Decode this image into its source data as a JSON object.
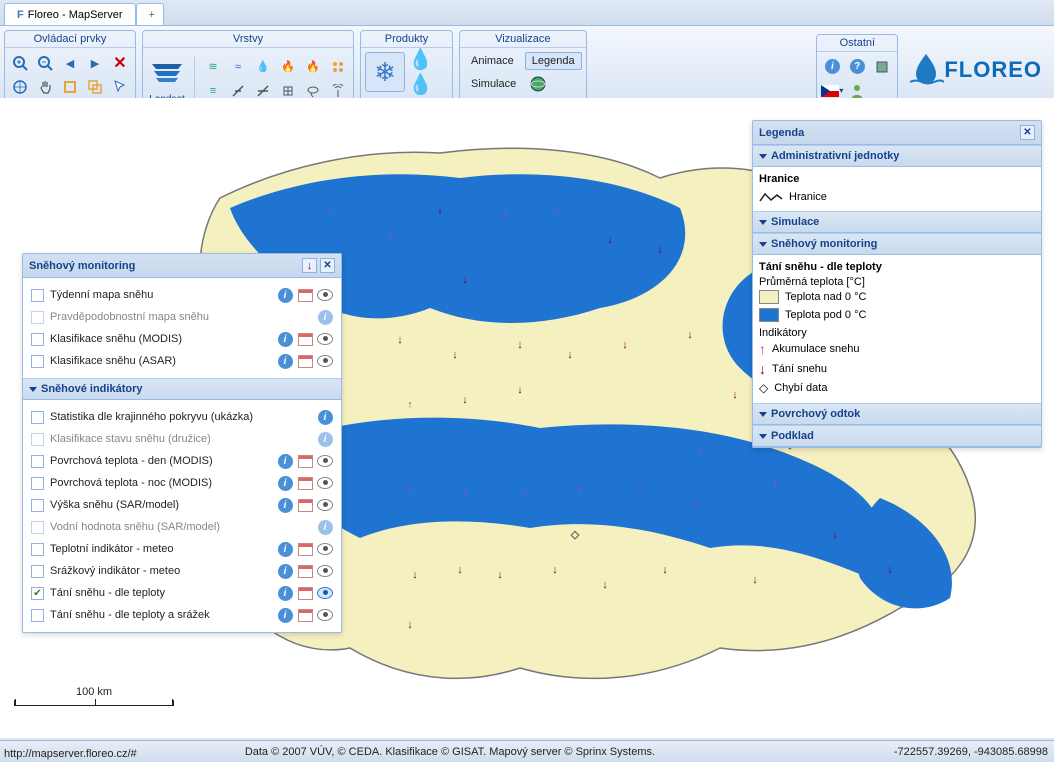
{
  "window": {
    "title": "Floreo - MapServer"
  },
  "ribbon": {
    "groups": {
      "controls": "Ovládací prvky",
      "layers": "Vrstvy",
      "products": "Produkty",
      "visualization": "Vizualizace",
      "other": "Ostatní"
    },
    "landsat": "Landsat",
    "vis": {
      "animace": "Animace",
      "legenda": "Legenda",
      "simulace": "Simulace"
    }
  },
  "brand": "FLOREO",
  "snowPanel": {
    "title": "Sněhový monitoring",
    "section1": {
      "items": [
        {
          "label": "Týdenní mapa sněhu",
          "checked": false,
          "cal": true,
          "eye": true
        },
        {
          "label": "Pravděpodobnostní mapa sněhu",
          "checked": false,
          "cal": false,
          "eye": false,
          "dim": true
        },
        {
          "label": "Klasifikace sněhu (MODIS)",
          "checked": false,
          "cal": true,
          "eye": true
        },
        {
          "label": "Klasifikace sněhu (ASAR)",
          "checked": false,
          "cal": true,
          "eye": true
        }
      ]
    },
    "section2": {
      "title": "Sněhové indikátory",
      "items": [
        {
          "label": "Statistika dle krajinného pokryvu (ukázka)",
          "checked": false,
          "cal": false,
          "eye": false
        },
        {
          "label": "Klasifikace stavu sněhu (družice)",
          "checked": false,
          "cal": false,
          "eye": false,
          "dim": true
        },
        {
          "label": "Povrchová teplota - den (MODIS)",
          "checked": false,
          "cal": true,
          "eye": true
        },
        {
          "label": "Povrchová teplota - noc (MODIS)",
          "checked": false,
          "cal": true,
          "eye": true
        },
        {
          "label": "Výška sněhu (SAR/model)",
          "checked": false,
          "cal": true,
          "eye": true
        },
        {
          "label": "Vodní hodnota sněhu (SAR/model)",
          "checked": false,
          "cal": false,
          "eye": false,
          "dim": true
        },
        {
          "label": "Teplotní indikátor - meteo",
          "checked": false,
          "cal": true,
          "eye": true
        },
        {
          "label": "Srážkový indikátor - meteo",
          "checked": false,
          "cal": true,
          "eye": true
        },
        {
          "label": "Tání sněhu - dle teploty",
          "checked": true,
          "cal": true,
          "eye": true,
          "eyeon": true
        },
        {
          "label": "Tání sněhu - dle teploty a srážek",
          "checked": false,
          "cal": true,
          "eye": true
        }
      ]
    }
  },
  "legend": {
    "title": "Legenda",
    "admin": {
      "title": "Administrativní jednotky",
      "hranice": "Hranice",
      "hraniceItem": "Hranice"
    },
    "simulace": "Simulace",
    "snow": {
      "title": "Sněhový monitoring",
      "heading": "Tání sněhu - dle teploty",
      "sub1": "Průměrná teplota [°C]",
      "above": "Teplota nad 0 °C",
      "below": "Teplota pod 0 °C",
      "ind": "Indikátory",
      "accum": "Akumulace snehu",
      "melt": "Tání snehu",
      "nodata": "Chybí data"
    },
    "runoff": "Povrchový odtok",
    "base": "Podklad"
  },
  "footer": {
    "scale": "100 km",
    "credits": "Data © 2007 VÚV, © CEDA. Klasifikace © GISAT. Mapový server © Sprinx Systems.",
    "coords": "-722557.39269, -943085.68998",
    "url": "http://mapserver.floreo.cz/#"
  }
}
